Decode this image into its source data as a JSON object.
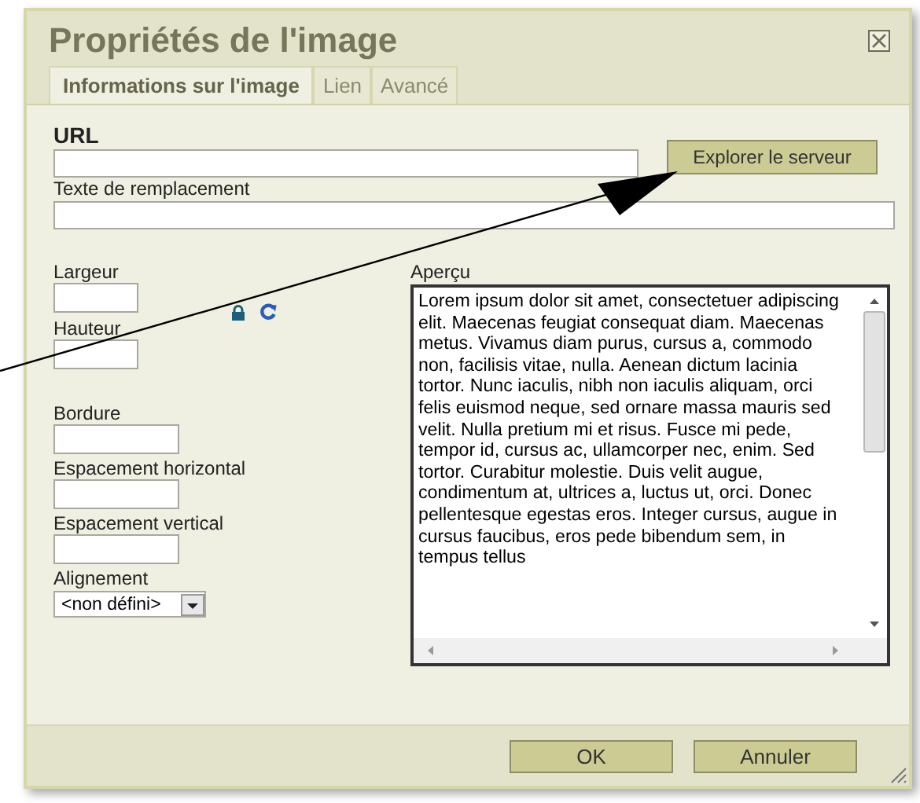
{
  "dialog": {
    "title": "Propriétés de l'image"
  },
  "tabs": [
    {
      "label": "Informations sur l'image",
      "selected": true
    },
    {
      "label": "Lien",
      "selected": false
    },
    {
      "label": "Avancé",
      "selected": false
    }
  ],
  "url": {
    "label": "URL"
  },
  "browse_button": "Explorer le serveur",
  "alt_text": {
    "label": "Texte de remplacement"
  },
  "size_fields": [
    {
      "label": "Largeur"
    },
    {
      "label": "Hauteur"
    }
  ],
  "spacing_fields": [
    {
      "label": "Bordure"
    },
    {
      "label": "Espacement horizontal"
    },
    {
      "label": "Espacement vertical"
    }
  ],
  "alignment": {
    "label": "Alignement",
    "value": "<non défini>"
  },
  "preview": {
    "label": "Aperçu",
    "text": "Lorem ipsum dolor sit amet, consectetuer adipiscing elit. Maecenas feugiat consequat diam. Maecenas metus. Vivamus diam purus, cursus a, commodo non, facilisis vitae, nulla. Aenean dictum lacinia tortor. Nunc iaculis, nibh non iaculis aliquam, orci felis euismod neque, sed ornare massa mauris sed velit. Nulla pretium mi et risus. Fusce mi pede, tempor id, cursus ac, ullamcorper nec, enim. Sed tortor. Curabitur molestie. Duis velit augue, condimentum at, ultrices a, luctus ut, orci. Donec pellentesque egestas eros. Integer cursus, augue in cursus faucibus, eros pede bibendum sem, in tempus tellus"
  },
  "buttons": [
    "OK",
    "Annuler"
  ]
}
